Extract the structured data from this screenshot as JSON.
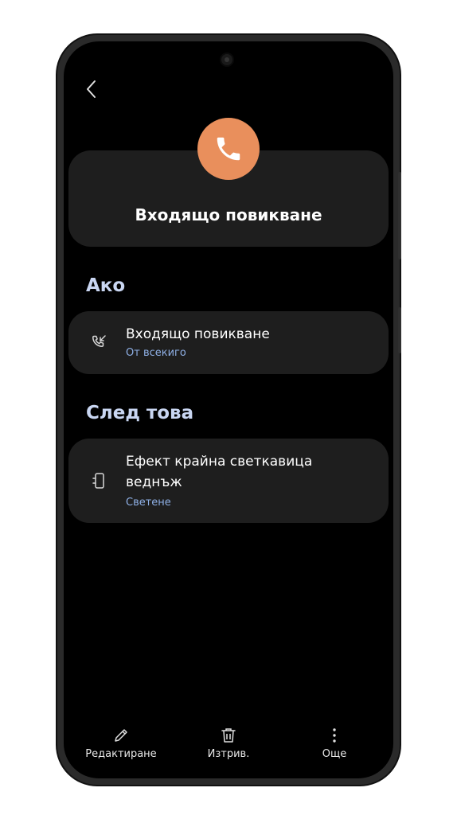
{
  "colors": {
    "accent": "#e98f5c",
    "section_title": "#c9d6f2",
    "subtitle": "#8fb0e6",
    "background": "#000000",
    "card": "#1e1e1e"
  },
  "nav": {
    "back_icon": "chevron-left-icon"
  },
  "header": {
    "icon": "phone-icon",
    "title": "Входящо повикване"
  },
  "if_section": {
    "title": "Ако",
    "item": {
      "icon": "incoming-call-icon",
      "title": "Входящо повикване",
      "subtitle": "От всекиго"
    }
  },
  "then_section": {
    "title": "След това",
    "item": {
      "icon": "phone-flash-icon",
      "title": "Ефект крайна светкавица веднъж",
      "subtitle": "Светене"
    }
  },
  "bottom_bar": {
    "edit": {
      "icon": "pencil-icon",
      "label": "Редактиране"
    },
    "delete": {
      "icon": "trash-icon",
      "label": "Изтрив."
    },
    "more": {
      "icon": "more-vertical-icon",
      "label": "Още"
    }
  }
}
